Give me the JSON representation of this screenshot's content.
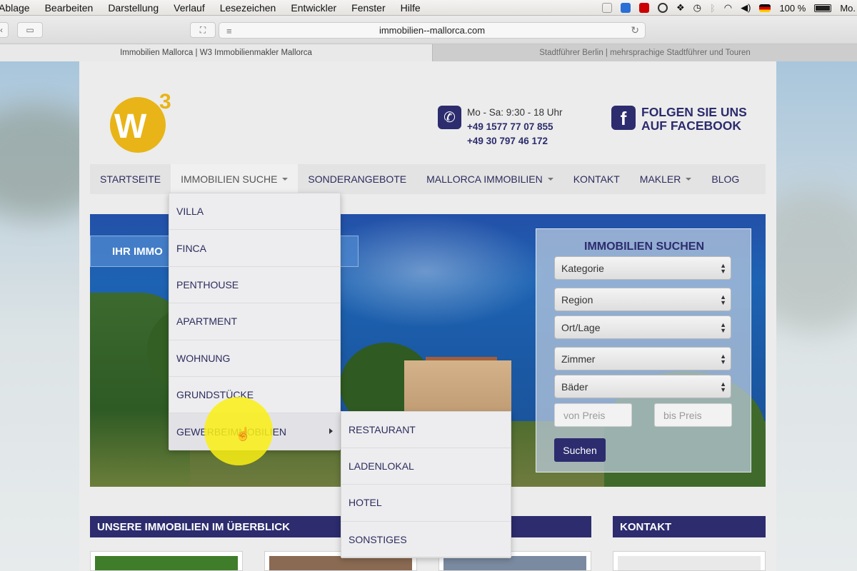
{
  "menubar": {
    "items": [
      "Ablage",
      "Bearbeiten",
      "Darstellung",
      "Verlauf",
      "Lesezeichen",
      "Entwickler",
      "Fenster",
      "Hilfe"
    ],
    "battery": "100 %",
    "user": "Mo."
  },
  "browser": {
    "url": "immobilien--mallorca.com",
    "tabs": [
      {
        "title": "Immobilien Mallorca | W3 Immobilienmakler Mallorca"
      },
      {
        "title": "Stadtführer Berlin | mehrsprachige Stadtführer und Touren"
      }
    ]
  },
  "site": {
    "logo": {
      "main": "W",
      "sup": "3"
    },
    "contact": {
      "hours": "Mo - Sa: 9:30 - 18 Uhr",
      "phone1": "+49 1577 77 07 855",
      "phone2": "+49 30 797 46 172"
    },
    "facebook": {
      "line1": "FOLGEN SIE UNS",
      "line2": "AUF FACEBOOK",
      "icon_letter": "f"
    },
    "nav": [
      {
        "label": "STARTSEITE"
      },
      {
        "label": "IMMOBILIEN SUCHE"
      },
      {
        "label": "SONDERANGEBOTE"
      },
      {
        "label": "MALLORCA IMMOBILIEN"
      },
      {
        "label": "KONTAKT"
      },
      {
        "label": "MAKLER"
      },
      {
        "label": "BLOG"
      }
    ],
    "hero_banner": "IHR IMMO",
    "search": {
      "title": "IMMOBILIEN SUCHEN",
      "selects": [
        "Kategorie",
        "Region",
        "Ort/Lage",
        "Zimmer",
        "Bäder"
      ],
      "price_from_placeholder": "von Preis",
      "price_to_placeholder": "bis Preis",
      "button": "Suchen"
    },
    "dropdown": [
      "VILLA",
      "FINCA",
      "PENTHOUSE",
      "APARTMENT",
      "WOHNUNG",
      "GRUNDSTÜCKE",
      "GEWERBEIMMOBILIEN"
    ],
    "submenu": [
      "RESTAURANT",
      "LADENLOKAL",
      "HOTEL",
      "SONSTIGES"
    ],
    "sections": {
      "overview": "UNSERE IMMOBILIEN IM ÜBERBLICK",
      "contact": "KONTAKT"
    }
  },
  "colors": {
    "brand_navy": "#2c2c6e",
    "logo_yellow": "#e8b417",
    "cursor_highlight": "#faf014"
  }
}
